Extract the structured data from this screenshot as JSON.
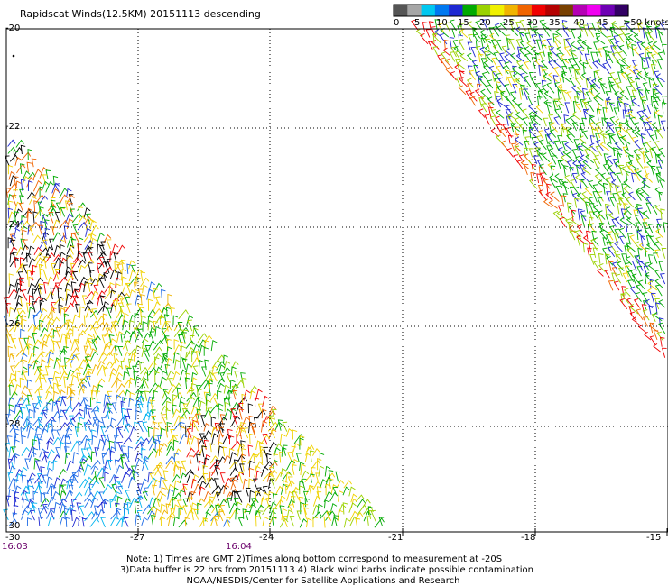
{
  "title": "Rapidscat Winds(12.5KM) 20151113 descending",
  "legend": {
    "colors": [
      "#555555",
      "#a6a6a6",
      "#00c8f0",
      "#0078f0",
      "#1e28d2",
      "#00aa00",
      "#9ad200",
      "#f0f000",
      "#f0b400",
      "#f06400",
      "#f00000",
      "#b40000",
      "#784000",
      "#b400b4",
      "#f000f0",
      "#6e00b4",
      "#320064"
    ],
    "labels": [
      "0",
      "5",
      "10",
      "15",
      "20",
      "25",
      "30",
      "35",
      "40",
      "45",
      ">50 knots"
    ]
  },
  "lat_labels": [
    "-20",
    "-22",
    "-24",
    "-26",
    "-28",
    "-30"
  ],
  "lon_labels": [
    "-30",
    "-27",
    "-24",
    "-21",
    "-18",
    "-15"
  ],
  "time_labels": [
    "16:03",
    "16:04"
  ],
  "notes": [
    "Note: 1) Times are GMT 2)Times along bottom correspond to measurement at -20S",
    "3)Data buffer is 22 hrs from 20151113 4) Black wind barbs indicate possible contamination",
    "NOAA/NESDIS/Center for Satellite Applications and Research"
  ]
}
